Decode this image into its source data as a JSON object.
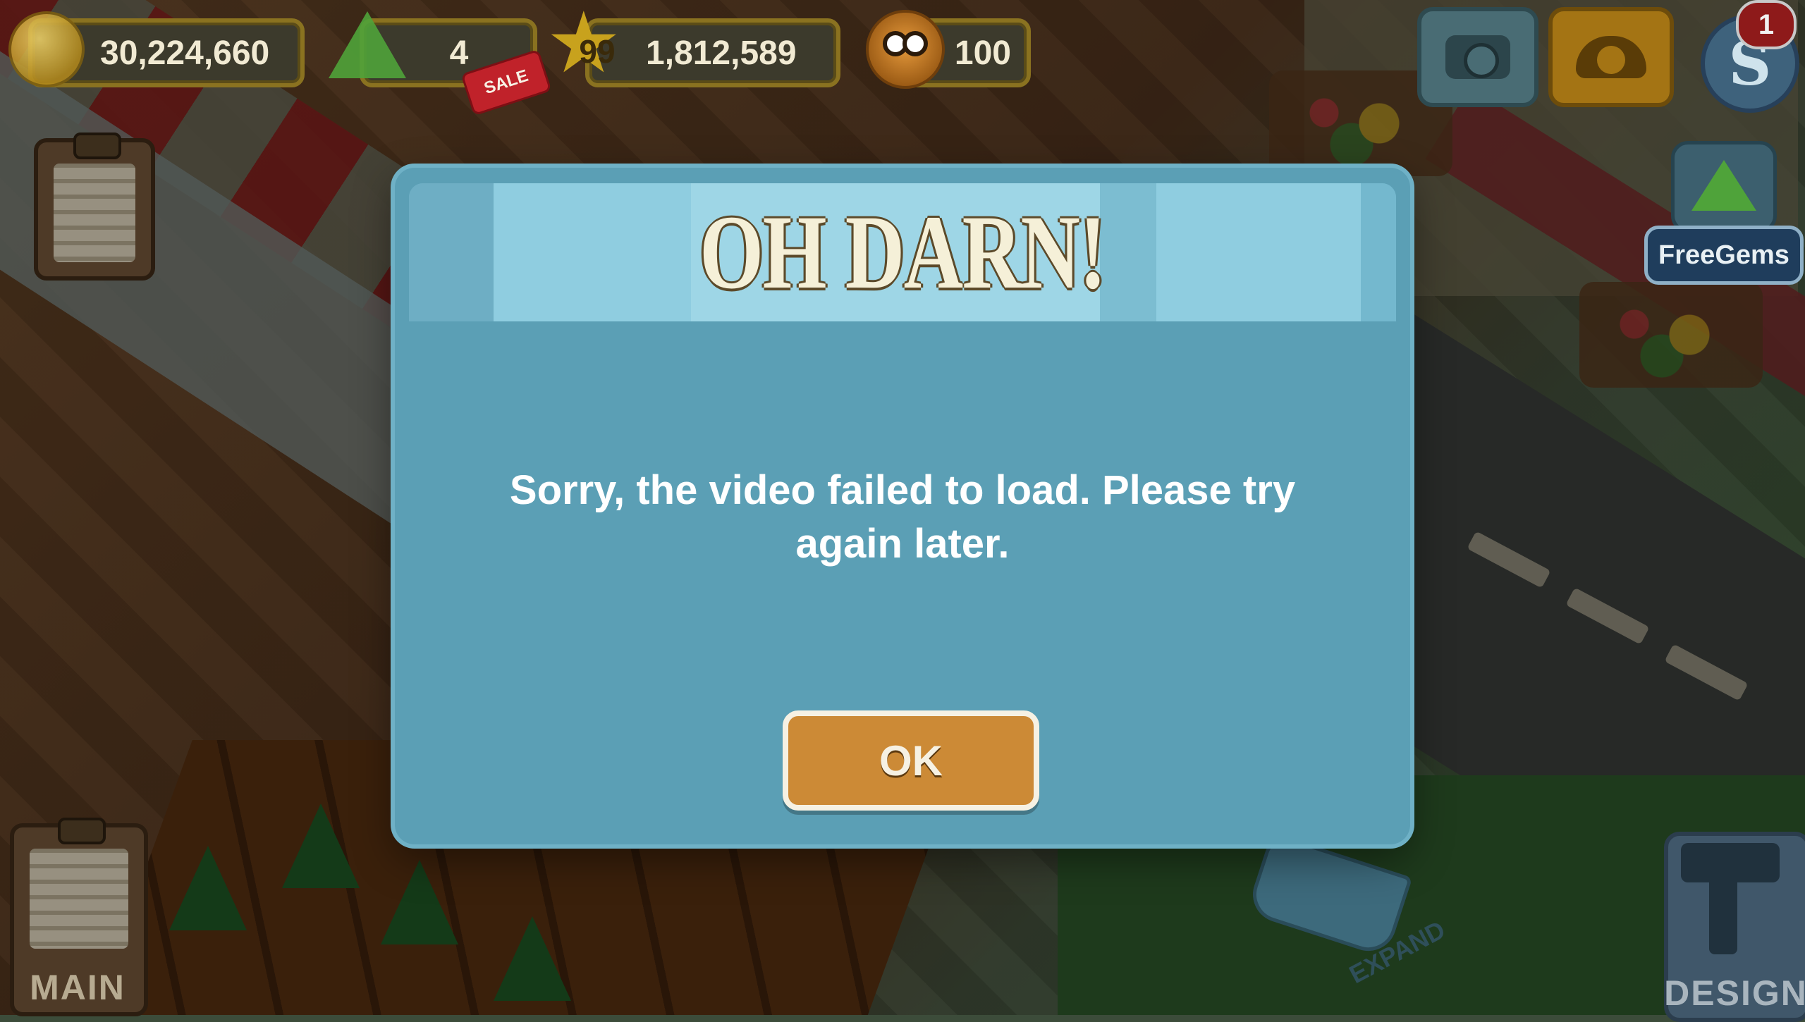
{
  "hud": {
    "coins": "30,224,660",
    "gems": "4",
    "sale_label": "SALE",
    "level": "99",
    "xp": "1,812,589",
    "rating": "100",
    "notification_count": "1",
    "s_label": "S",
    "free_gems_label": "FreeGems"
  },
  "icons": {
    "coin": "coin-icon",
    "gem": "gem-icon",
    "level": "star-icon",
    "rating": "smiley-face-icon",
    "camera": "camera-icon",
    "phone": "phone-icon",
    "main_menu": "clipboard-icon",
    "design": "hammer-icon",
    "expand": "arrow-icon"
  },
  "bottom": {
    "main_label": "MAIN",
    "design_label": "DESIGN",
    "expand_label": "EXPAND"
  },
  "dialog": {
    "title": "OH DARN!",
    "message": "Sorry, the video failed to load.  Please try again later.",
    "ok_label": "OK"
  },
  "colors": {
    "dialog_bg": "#5b9fb5",
    "dialog_header": "#74b8ce",
    "ok_button": "#cc8a36",
    "title_text": "#f5f0d8"
  }
}
